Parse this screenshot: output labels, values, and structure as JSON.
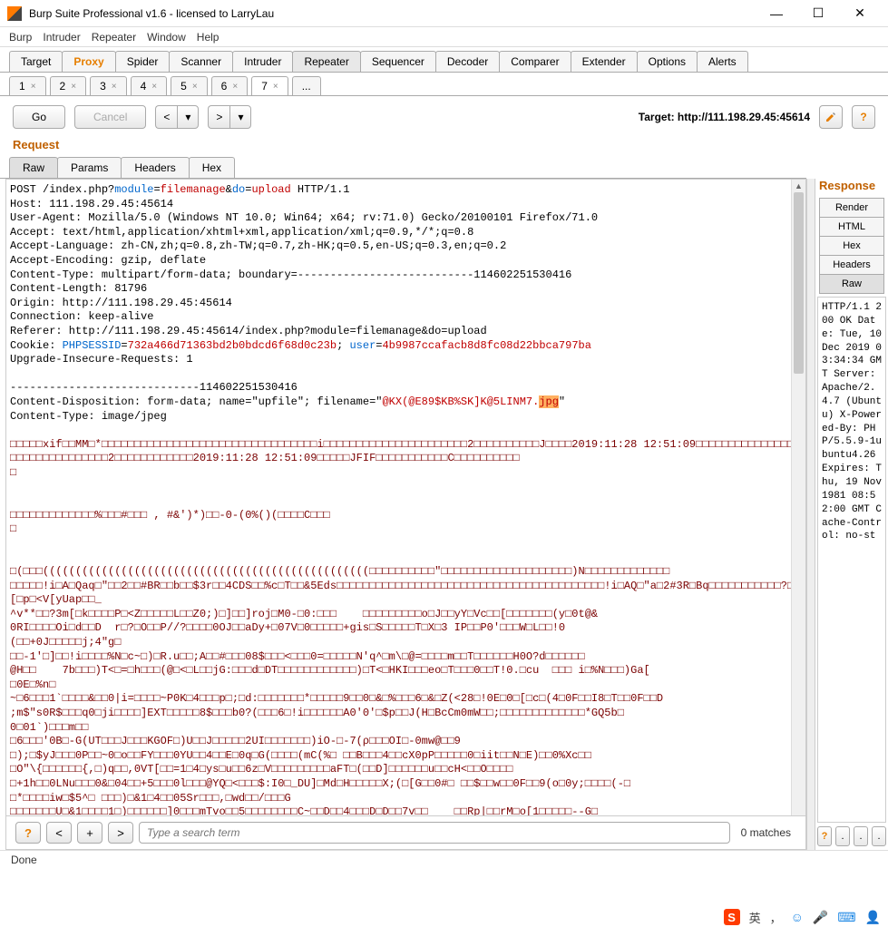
{
  "window": {
    "title": "Burp Suite Professional v1.6 - licensed to LarryLau"
  },
  "menu": [
    "Burp",
    "Intruder",
    "Repeater",
    "Window",
    "Help"
  ],
  "tabs": [
    "Target",
    "Proxy",
    "Spider",
    "Scanner",
    "Intruder",
    "Repeater",
    "Sequencer",
    "Decoder",
    "Comparer",
    "Extender",
    "Options",
    "Alerts"
  ],
  "num_tabs": [
    "1",
    "2",
    "3",
    "4",
    "5",
    "6",
    "7",
    "..."
  ],
  "actions": {
    "go": "Go",
    "cancel": "Cancel",
    "target_label": "Target: http://111.198.29.45:45614"
  },
  "request": {
    "title": "Request",
    "subtabs": [
      "Raw",
      "Params",
      "Headers",
      "Hex"
    ],
    "line1_a": "POST /index.php?",
    "line1_p1": "module",
    "line1_v1": "filemanage",
    "line1_amp": "&",
    "line1_p2": "do",
    "line1_v2": "upload",
    "line1_b": " HTTP/1.1",
    "host": "Host: 111.198.29.45:45614",
    "ua": "User-Agent: Mozilla/5.0 (Windows NT 10.0; Win64; x64; rv:71.0) Gecko/20100101 Firefox/71.0",
    "accept": "Accept: text/html,application/xhtml+xml,application/xml;q=0.9,*/*;q=0.8",
    "acceptlang": "Accept-Language: zh-CN,zh;q=0.8,zh-TW;q=0.7,zh-HK;q=0.5,en-US;q=0.3,en;q=0.2",
    "acceptenc": "Accept-Encoding: gzip, deflate",
    "ctype": "Content-Type: multipart/form-data; boundary=---------------------------114602251530416",
    "clen": "Content-Length: 81796",
    "origin": "Origin: http://111.198.29.45:45614",
    "conn": "Connection: keep-alive",
    "referer": "Referer: http://111.198.29.45:45614/index.php?module=filemanage&do=upload",
    "cookie_lbl": "Cookie: ",
    "cookie_k1": "PHPSESSID",
    "cookie_v1": "732a466d71363bd2b0bdcd6f68d0c23b",
    "cookie_sep": "; ",
    "cookie_k2": "user",
    "cookie_v2": "4b9987ccafacb8d8fc08d22bbca797ba",
    "upgrade": "Upgrade-Insecure-Requests: 1",
    "boundary": "-----------------------------114602251530416",
    "cdisp_a": "Content-Disposition: form-data; name=\"upfile\"; filename=\"",
    "cdisp_fn": "@KX(@E89$KB%SK]K@5LINM7.",
    "cdisp_ext": "jpg",
    "cdisp_b": "\"",
    "ctype2": "Content-Type: image/jpeg",
    "bin1": "□□□□□xif□□MM□*□□□□□□□□□□□□□□□□□□□□□□□□□□□□□□□□□i□□□□□□□□□□□□□□□□□□□□□□2□□□□□□□□□□J□□□□2019:11:28 12:51:09□□□□□□□□□□□□□□□□□□□□□□□□□□□□□□□2□□□□□□□□□□□□2019:11:28 12:51:09□□□□□JFIF□□□□□□□□□□□C□□□□□□□□□□",
    "bin2": "□",
    "bin3": "□□□□□□□□□□□□□%□□□#□□□ , #&')*)□□-0-(0%()(□□□□C□□□",
    "bin4": "□",
    "bin5": "□(□□□((((((((((((((((((((((((((((((((((((((((((((((((((□□□□□□□□□□\"□□□□□□□□□□□□□□□□□□□□)N□□□□□□□□□□□□□",
    "bin6": "□□□□□!i□A□Qaq□\"□□2□□#BR□□b□□$3r□□4CDS□□%c□T□□&5Eds□□□□□□□□□□□□□□□□□□□□□□□□□□□□□□□□□□□□□□□□□!i□AQ□\"a□2#3R□Bq□□□□□□□□□□□?□~[□p□<V[yUap□□_",
    "bin7": "^v**□□?3m[□k□□□□P□<Z□□□□□L□□Z0;)□]□□]roj□M0-□0:□□□    □□□□□□□□□o□J□□yY□Vc□□[□□□□□□□(y□0t@&",
    "bin8": "0RI□□□□Oi□d□□D  r□?□O□□P//?□□□□0OJ□□aDy+□07V□0□□□□□+gis□S□□□□□T□X□3 IP□□P0'□□□W□L□□!0",
    "bin9": "(□□+0J□□□□□j;4\"g□",
    "bin10": "□□-1'□]□□!i□□□□%N□c~□)□R.u□□;A□□#□□□08$□□□<□□□0=□□□□□N'q^□m\\□@=□□□□m□□T□□□□□□H0O?d□□□□□□",
    "bin11": "@H□□    7b□□□)T<□=□h□□□(@□<□L□□jG:□□□d□DT□□□□□□□□□□□□)□T<□HKI□□□eo□T□□□0□□T!0.□cu  □□□ i□%N□□□)Ga[",
    "bin12": "□0E□%n□",
    "bin13": "~□6□□□1`□□□□&□□0|i=□□□□~P0K□4□□□p□;□d:□□□□□□□*□□□□□9□□0□&□%□□□6□&□Z(<28□!0E□0□[□c□(4□0F□□I8□T□□0F□□D",
    "bin14": ";m$\"s0R$□□□q0□ji□□□□]EXT□□□□□8$□□□b0?(□□□6□!i□□□□□□A0'0'□$p□□J(H□BcCm0mW□□;□□□□□□□□□□□□□*GQ5b□",
    "bin15": "0□01`)□□□m□□",
    "bin16": "□6□□□'0B□-G(UT□□□J□□□KGOF□)U□□J□□□□□2UI□□□□□□□)iO-□-7(ρ□□□OI□-0mw@□□9",
    "bin17": "□);□$yJ□□□0P□□~0□o□□FY□□□0YU□□4□□E□0q□G(□□□□(mC(%□ □□B□□□4□□cX0pP□□□□□0□iit□□N□E)□□0%Xc□□",
    "bin18": "□O\"\\{□□□□□□{,□)q□□,0VT[□□=1□4□ys□u□□6z□V□□□□□□□□□aFT□(□□D]□□□□□□u□□cH<□□O□□□□",
    "bin19": "□+1h□□0LNu□□□0&□04□□+5□□□0l□□□@YQ□<□□□$:I0□_DU]□Md□H□□□□□X;(□[G□□0#□ □□$□□w□□0F□□9(o□0y;□□□□(-□",
    "bin20": "□*□□□□iw□$5^□ □□□)□&1□4□□05Sr□□□,□wd□□/□□□G",
    "bin21": "□□□□□□□U□&1□□□□1□)□□□□□□]0□□□mTvo□□5□□□□□□□□C~□□D□□4□□□D□D□□7v□□    □□Rp|□□rM□o[1□□□□□--G□"
  },
  "response": {
    "title": "Response",
    "tabs": [
      "Render",
      "HTML",
      "Hex",
      "Headers",
      "Raw"
    ],
    "text": "HTTP/1.1 200 OK\nDate:\n\nTue, 10 Dec 2019 03:34:34 GMT\nServer:\nApache/2.4.7 (Ubuntu)\nX-Powered-By: PHP/5.5.9-1ubuntu4.26\nExpires:\nThu, 19 Nov 1981 08:52:00 GMT\nCache-Control: no-st"
  },
  "search": {
    "placeholder": "Type a search term",
    "matches": "0 matches"
  },
  "status": "Done",
  "ime": {
    "s": "S",
    "ch": "英",
    "comma": "，",
    "dot": "•"
  }
}
